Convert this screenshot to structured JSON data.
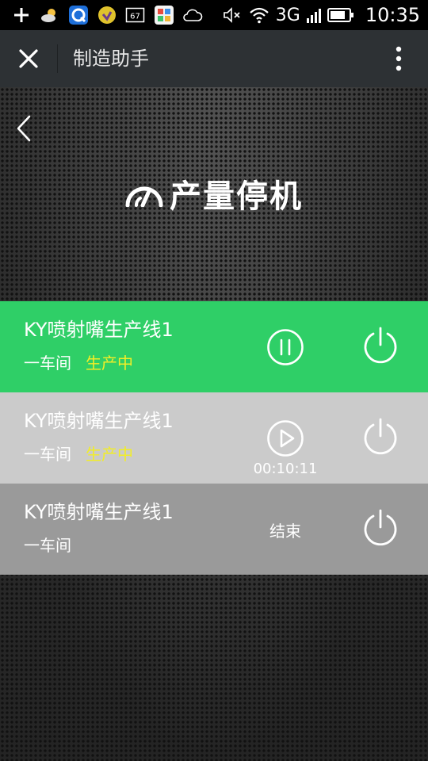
{
  "status_bar": {
    "battery_badge": "67",
    "network": "3G",
    "time": "10:35"
  },
  "title_bar": {
    "title": "制造助手"
  },
  "page": {
    "title": "产量停机"
  },
  "lines": [
    {
      "name": "KY喷射嘴生产线1",
      "workshop": "一车间",
      "status": "生产中",
      "status_color": "#f2ee27",
      "background": "#2fcf67",
      "action": "pause"
    },
    {
      "name": "KY喷射嘴生产线1",
      "workshop": "一车间",
      "status": "生产中",
      "status_color": "#f2ee27",
      "background": "#cbcbcb",
      "action": "play",
      "timer": "00:10:11"
    },
    {
      "name": "KY喷射嘴生产线1",
      "workshop": "一车间",
      "background": "#9a9a9a",
      "action_label": "结束"
    }
  ],
  "icons": {
    "status_bar": [
      "plus-icon",
      "weather-icon",
      "q-app-icon",
      "gift-icon",
      "battery-badge-icon",
      "gallery-icon",
      "cloud-icon",
      "mute-icon",
      "wifi-icon",
      "signal-icon",
      "battery-icon"
    ],
    "title_bar": [
      "close-icon",
      "more-vertical-icon"
    ],
    "page": [
      "back-arrow-icon",
      "gauge-logo-icon",
      "pause-icon",
      "play-icon",
      "power-icon"
    ]
  }
}
